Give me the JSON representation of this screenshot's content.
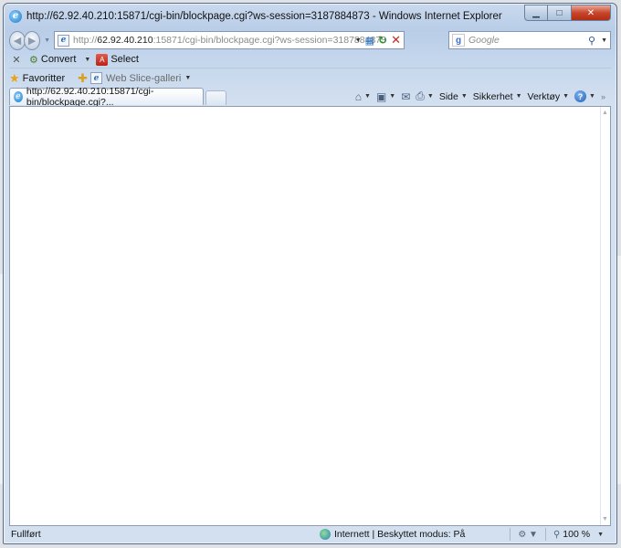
{
  "window": {
    "title": "http://62.92.40.210:15871/cgi-bin/blockpage.cgi?ws-session=3187884873 - Windows Internet Explorer"
  },
  "address": {
    "url_prefix": "http://",
    "url_host": "62.92.40.210",
    "url_rest": ":15871/cgi-bin/blockpage.cgi?ws-session=3187884873"
  },
  "search": {
    "placeholder": "Google"
  },
  "command_bar": {
    "convert_label": "Convert",
    "select_label": "Select"
  },
  "favorites_bar": {
    "favorites_label": "Favoritter",
    "web_slice_label": "Web Slice-galleri"
  },
  "tabs": [
    {
      "label": "http://62.92.40.210:15871/cgi-bin/blockpage.cgi?..."
    }
  ],
  "tab_tools": {
    "page_label": "Side",
    "safety_label": "Sikkerhet",
    "tools_label": "Verktøy"
  },
  "status": {
    "text": "Fullført",
    "zone": "Internett | Beskyttet modus: På",
    "zoom": "100 %"
  }
}
